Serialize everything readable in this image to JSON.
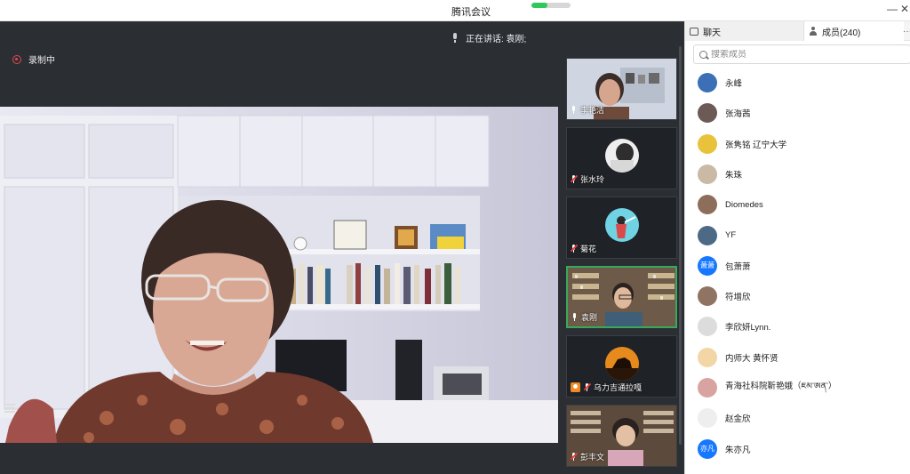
{
  "window": {
    "title": "腾讯会议",
    "network_quality": 0.4,
    "controls": {
      "minimize": "—",
      "close": "✕"
    }
  },
  "meeting": {
    "recording_label": "录制中",
    "speaking_label": "正在讲话: 袁刚;",
    "nav_prev": "◀",
    "nav_next": "▶"
  },
  "thumbnails": [
    {
      "name": "李艳洁",
      "mic": "active"
    },
    {
      "name": "张水玲",
      "mic": "muted"
    },
    {
      "name": "菊花",
      "mic": "muted"
    },
    {
      "name": "袁刚",
      "mic": "active",
      "active": true
    },
    {
      "name": "乌力吉通拉嘎",
      "mic": "muted"
    },
    {
      "name": "彭丰文",
      "mic": "muted"
    }
  ],
  "panel": {
    "tab_chat": "聊天",
    "tab_members": "成员(240)",
    "tab_more": "···",
    "search_placeholder": "搜索成员",
    "members": [
      {
        "name": "永峰",
        "avatar": "#3b6fb6"
      },
      {
        "name": "张海茜",
        "avatar": "#6d5a57"
      },
      {
        "name": "张隽铭 辽宁大学",
        "avatar": "#e8c23a"
      },
      {
        "name": "朱珠",
        "avatar": "#c9b9a5"
      },
      {
        "name": "Diomedes",
        "avatar": "#8d6e5a"
      },
      {
        "name": "YF",
        "avatar": "#4c6a86"
      },
      {
        "name": "包萧萧",
        "avatar": "#1677ff",
        "initials": "萧萧"
      },
      {
        "name": "符增欣",
        "avatar": "#8f7463"
      },
      {
        "name": "李欣妍Lynn.",
        "avatar": "#dcdcdc"
      },
      {
        "name": "内师大 黄怀贤",
        "avatar": "#f2d6a5"
      },
      {
        "name": "青海社科院靳艳娥（ཇམ་ཨན་）",
        "avatar": "#d8a3a0"
      },
      {
        "name": "赵金欣",
        "avatar": "#eeeeee"
      },
      {
        "name": "朱亦凡",
        "avatar": "#1677ff",
        "initials": "亦凡"
      }
    ]
  }
}
